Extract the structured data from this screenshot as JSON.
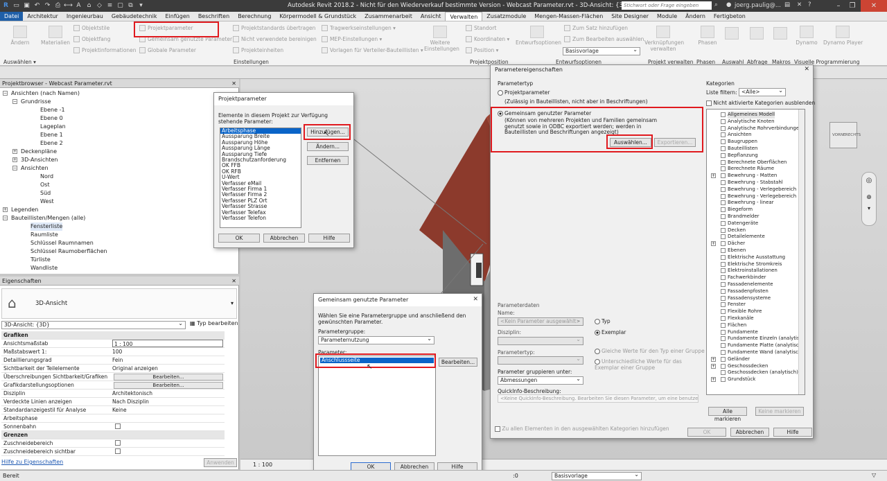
{
  "window": {
    "title": "Autodesk Revit 2018.2 - Nicht für den Wiederverkauf bestimmte Version -   Webcast Parameter.rvt - 3D-Ansicht: {3D}",
    "search_placeholder": "Stichwort oder Frage eingeben",
    "user": "joerg.paulig@..."
  },
  "tabs": [
    "Datei",
    "Architektur",
    "Ingenieurbau",
    "Gebäudetechnik",
    "Einfügen",
    "Beschriften",
    "Berechnung",
    "Körpermodell & Grundstück",
    "Zusammenarbeit",
    "Ansicht",
    "Verwalten",
    "Zusatzmodule",
    "Mengen-Massen-Flächen",
    "Site Designer",
    "Module",
    "Ändern",
    "Fertigbeton"
  ],
  "ribbon": {
    "aendern": "Ändern",
    "auswaehlen": "Auswählen ▾",
    "materialien": "Materialien",
    "objektstile": "Objektstile",
    "objektfang": "Objektfang",
    "projektinformationen": "Projektinformationen",
    "projektparameter": "Projektparameter",
    "gemeinsam": "Gemeinsam genutzte Parameter",
    "globale": "Globale  Parameter",
    "projektstandards": "Projektstandards übertragen",
    "nicht_verwendete": "Nicht verwendete bereinigen",
    "projekteinheiten": "Projekteinheiten",
    "tragwerk": "Tragwerkseinstellungen ▾",
    "mep": "MEP-Einstellungen ▾",
    "vorlagen": "Vorlagen für Verteiler-Bauteillisten ▾",
    "weitere": "Weitere Einstellungen",
    "standort": "Standort",
    "koordinaten": "Koordinaten ▾",
    "position": "Position ▾",
    "entwurfsoptionen_btn": "Entwurfsoptionen",
    "satz": "Zum Satz hinzufügen",
    "bearbeiten_ausw": "Zum Bearbeiten auswählen",
    "basisvorlage": "Basisvorlage",
    "verknuepfungen": "Verknüpfungen verwalten",
    "phasen_btn": "Phasen",
    "dynamo": "Dynamo",
    "dynamo_player": "Dynamo Player",
    "panels": [
      "Einstellungen",
      "Projektposition",
      "Entwurfsoptionen",
      "Projekt verwalten",
      "Phasen",
      "Auswahl",
      "Abfrage",
      "Makros",
      "Visuelle Programmierung"
    ]
  },
  "project_browser": {
    "title": "Projektbrowser - Webcast Parameter.rvt",
    "items": [
      {
        "label": "Ansichten (nach Namen)",
        "level": 0,
        "toggle": "−"
      },
      {
        "label": "Grundrisse",
        "level": 1,
        "toggle": "−"
      },
      {
        "label": "Ebene -1",
        "level": 3
      },
      {
        "label": "Ebene 0",
        "level": 3
      },
      {
        "label": "Lageplan",
        "level": 3
      },
      {
        "label": "Ebene 1",
        "level": 3
      },
      {
        "label": "Ebene 2",
        "level": 3
      },
      {
        "label": "Deckenpläne",
        "level": 1,
        "toggle": "+"
      },
      {
        "label": "3D-Ansichten",
        "level": 1,
        "toggle": "+"
      },
      {
        "label": "Ansichten",
        "level": 1,
        "toggle": "−"
      },
      {
        "label": "Nord",
        "level": 3
      },
      {
        "label": "Ost",
        "level": 3
      },
      {
        "label": "Süd",
        "level": 3
      },
      {
        "label": "West",
        "level": 3
      },
      {
        "label": "Legenden",
        "level": 0,
        "toggle": "+"
      },
      {
        "label": "Bauteillisten/Mengen (alle)",
        "level": 0,
        "toggle": "−"
      },
      {
        "label": "Fensterliste",
        "level": 2,
        "selected": true
      },
      {
        "label": "Raumliste",
        "level": 2
      },
      {
        "label": "Schlüssel Raumnamen",
        "level": 2
      },
      {
        "label": "Schlüssel Raumoberflächen",
        "level": 2
      },
      {
        "label": "Türliste",
        "level": 2
      },
      {
        "label": "Wandliste",
        "level": 2
      }
    ]
  },
  "properties": {
    "title": "Eigenschaften",
    "type_name": "3D-Ansicht",
    "instance_selector": "3D-Ansicht: {3D}",
    "edit_type": "Typ bearbeiten",
    "rows": [
      {
        "k": "Grafiken",
        "group": true
      },
      {
        "k": "Ansichtsmaßstab",
        "v": "1 : 100",
        "field": true
      },
      {
        "k": "Maßstabswert 1:",
        "v": "100"
      },
      {
        "k": "Detaillierungsgrad",
        "v": "Fein"
      },
      {
        "k": "Sichtbarkeit der Teilelemente",
        "v": "Original anzeigen"
      },
      {
        "k": "Überschreibungen Sichtbarkeit/Grafiken",
        "btn": "Bearbeiten..."
      },
      {
        "k": "Grafikdarstellungsoptionen",
        "btn": "Bearbeiten..."
      },
      {
        "k": "Disziplin",
        "v": "Architektonisch"
      },
      {
        "k": "Verdeckte Linien anzeigen",
        "v": "Nach Disziplin"
      },
      {
        "k": "Standardanzeigestil für Analyse",
        "v": "Keine"
      },
      {
        "k": "Arbeitsphase",
        "v": ""
      },
      {
        "k": "Sonnenbahn",
        "check": true
      },
      {
        "k": "Grenzen",
        "group": true
      },
      {
        "k": "Zuschneidebereich",
        "check": true
      },
      {
        "k": "Zuschneidebereich sichtbar",
        "check": true
      }
    ],
    "help_link": "Hilfe zu Eigenschaften",
    "apply": "Anwenden"
  },
  "dlg_projektparameter": {
    "title": "Projektparameter",
    "description": "Elemente in diesem Projekt zur Verfügung stehende Parameter:",
    "items": [
      "Arbeitsphase",
      "Aussparung Breite",
      "Aussparung Höhe",
      "Aussparung Länge",
      "Aussparung Tiefe",
      "Brandschutzanforderung",
      "OK FFB",
      "OK RFB",
      "U-Wert",
      "Verfasser eMail",
      "Verfasser Firma 1",
      "Verfasser Firma 2",
      "Verfasser PLZ Ort",
      "Verfasser Strasse",
      "Verfasser Telefax",
      "Verfasser Telefon"
    ],
    "add": "Hinzufügen...",
    "modify": "Ändern...",
    "remove": "Entfernen",
    "ok": "OK",
    "cancel": "Abbrechen",
    "help": "Hilfe"
  },
  "dlg_gemeinsam": {
    "title": "Gemeinsam genutzte Parameter",
    "description": "Wählen Sie eine Parametergruppe und anschließend den gewünschten Parameter.",
    "group_label": "Parametergruppe:",
    "group_value": "Parameternutzung",
    "param_label": "Parameter:",
    "param_selected": "Anschlussseite",
    "edit": "Bearbeiten...",
    "ok": "OK",
    "cancel": "Abbrechen",
    "help": "Hilfe"
  },
  "dlg_eigenschaften": {
    "title": "Parametereigenschaften",
    "paramtyp": "Parametertyp",
    "projektparameter": "Projektparameter",
    "projekt_hint": "(Zulässig in Bauteillisten, nicht aber in Beschriftungen)",
    "gemeinsam": "Gemeinsam genutzter Parameter",
    "gemeinsam_hint": "(Können von mehreren Projekten und Familien gemeinsam genutzt sowie in ODBC exportiert werden; werden in Bauteillisten und Beschriftungen angezeigt)",
    "auswaehlen": "Auswählen...",
    "exportieren": "Exportieren...",
    "paramdaten": "Parameterdaten",
    "name_label": "Name:",
    "name_value": "<Kein Parameter ausgewählt>",
    "typ": "Typ",
    "exemplar": "Exemplar",
    "disziplin": "Disziplin:",
    "parametertyp": "Parametertyp:",
    "gleiche": "Gleiche Werte für den Typ einer Gruppe",
    "unterschiedliche": "Unterschiedliche Werte für das Exemplar einer Gruppe",
    "gruppieren": "Parameter gruppieren unter:",
    "gruppieren_value": "Abmessungen",
    "quickinfo": "QuickInfo-Beschreibung:",
    "quickinfo_value": "<Keine QuickInfo-Beschreibung. Bearbeiten Sie diesen Parameter, um eine benutzer defini...",
    "alle_elemente": "Zu allen Elementen in den ausgewählten Kategorien hinzufügen",
    "kategorien": "Kategorien",
    "filter_label": "Liste filtern:",
    "filter_value": "<Alle>",
    "hide_inactive": "Nicht aktivierte Kategorien ausblenden",
    "categories": [
      "Allgemeines Modell",
      "Analytische Knoten",
      "Analytische Rohrverbindungen",
      "Ansichten",
      "Baugruppen",
      "Bauteillisten",
      "Bepflanzung",
      "Berechnete Oberflächen",
      "Berechnete Räume",
      "Bewehrung - Matten",
      "Bewehrung - Stabstahl",
      "Bewehrung - Verlegebereich Flä...",
      "Bewehrung - Verlegebereich Mat...",
      "Bewehrung - linear",
      "Biegeform",
      "Brandmelder",
      "Datengeräte",
      "Decken",
      "Detailelemente",
      "Dächer",
      "Ebenen",
      "Elektrische Ausstattung",
      "Elektrische Stromkreis",
      "Elektroinstallationen",
      "Fachwerkbinder",
      "Fassadenelemente",
      "Fassadenpfosten",
      "Fassadensysteme",
      "Fenster",
      "Flexible Rohre",
      "Flexkanäle",
      "Flächen",
      "Fundamente",
      "Fundamente Einzeln (analytisch)",
      "Fundamente Platte (analytisch)",
      "Fundamente Wand (analytisch)",
      "Geländer",
      "Geschossdecken",
      "Geschossdecken (analytisch)",
      "Grundstück"
    ],
    "mark_all": "Alle markieren",
    "unmark_all": "Keine markieren",
    "ok": "OK",
    "cancel": "Abbrechen",
    "help": "Hilfe"
  },
  "viewcube": {
    "left": "VORNE",
    "right": "RECHTS"
  },
  "view_scale": "1 : 100",
  "status": {
    "left": "Bereit",
    "zero": ":0",
    "model": "Basisvorlage"
  }
}
